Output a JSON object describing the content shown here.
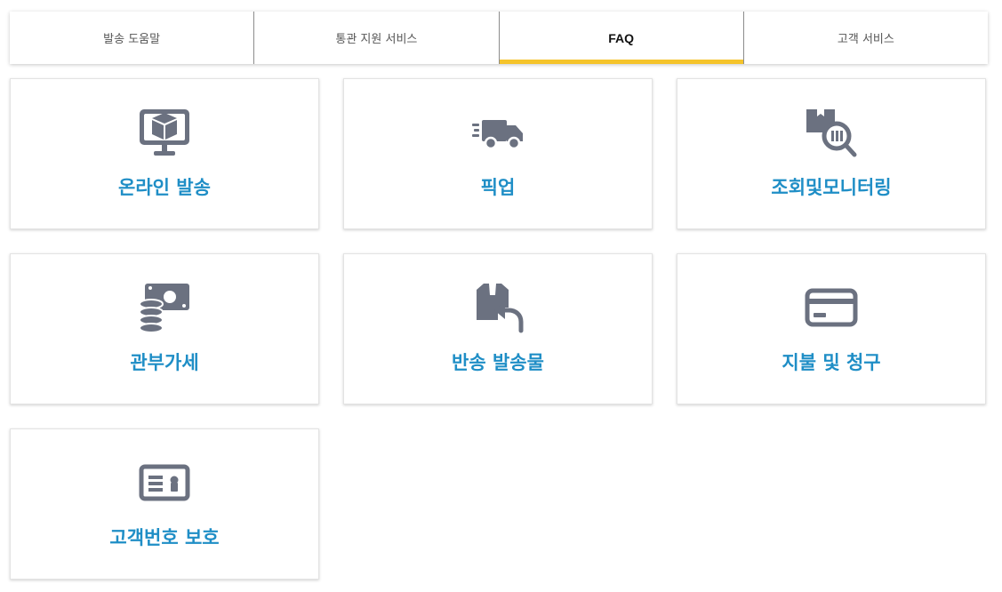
{
  "tabs": [
    {
      "label": "발송 도움말",
      "active": false
    },
    {
      "label": "통관 지원 서비스",
      "active": false
    },
    {
      "label": "FAQ",
      "active": true
    },
    {
      "label": "고객 서비스",
      "active": false
    }
  ],
  "colors": {
    "accent": "#f5c42b",
    "link": "#1f8ec6",
    "icon": "#6b7180"
  },
  "cards": [
    {
      "label": "온라인 발송",
      "icon": "online-shipping-icon"
    },
    {
      "label": "픽업",
      "icon": "pickup-truck-icon"
    },
    {
      "label": "조회및모니터링",
      "icon": "tracking-search-icon"
    },
    {
      "label": "관부가세",
      "icon": "duties-taxes-icon"
    },
    {
      "label": "반송 발송물",
      "icon": "return-shipment-icon"
    },
    {
      "label": "지불 및 청구",
      "icon": "credit-card-icon"
    },
    {
      "label": "고객번호 보호",
      "icon": "id-card-icon"
    }
  ]
}
